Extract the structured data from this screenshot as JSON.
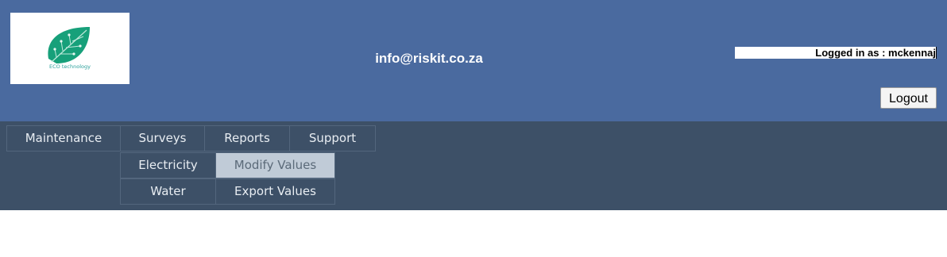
{
  "header": {
    "logo_text": "ECO technology",
    "email": "info@riskit.co.za",
    "logged_in": "Logged in as : mckennaj",
    "logout_label": "Logout"
  },
  "menu": {
    "maintenance": "Maintenance",
    "surveys": "Surveys",
    "reports": "Reports",
    "support": "Support",
    "electricity": "Electricity",
    "modify_values": "Modify Values",
    "water": "Water",
    "export_values": "Export Values"
  },
  "colors": {
    "header_bg": "#4a6a9f",
    "nav_bg": "#3d5067",
    "active_item_bg": "#c0cbd7",
    "logo_green": "#1aa37a"
  }
}
